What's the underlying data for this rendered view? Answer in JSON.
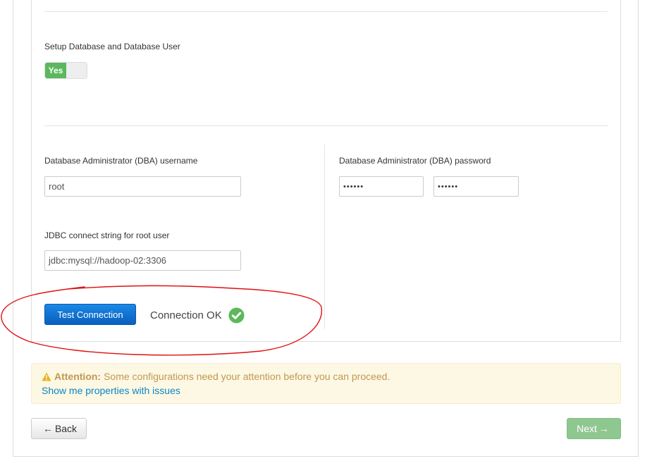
{
  "setup_db": {
    "label": "Setup Database and Database User",
    "toggle_value": "Yes"
  },
  "dba_username": {
    "label": "Database Administrator (DBA) username",
    "value": "root"
  },
  "dba_password": {
    "label": "Database Administrator (DBA) password",
    "value": "••••••",
    "confirm_value": "••••••"
  },
  "jdbc": {
    "label": "JDBC connect string for root user",
    "value": "jdbc:mysql://hadoop-02:3306"
  },
  "test_connection": {
    "button_label": "Test Connection",
    "status_text": "Connection OK"
  },
  "alert": {
    "title": "Attention:",
    "message": "Some configurations need your attention before you can proceed.",
    "link_text": "Show me properties with issues"
  },
  "nav": {
    "back_arrow": "←",
    "back_label": "Back",
    "next_label": "Next",
    "next_arrow": "→"
  },
  "colors": {
    "success": "#5cb85c",
    "primary": "#0a5fbd",
    "warning_text": "#c09853",
    "link": "#0f85c8",
    "annotation": "#e01010"
  },
  "icons": {
    "check": "check-circle-icon",
    "warning": "warning-icon"
  }
}
